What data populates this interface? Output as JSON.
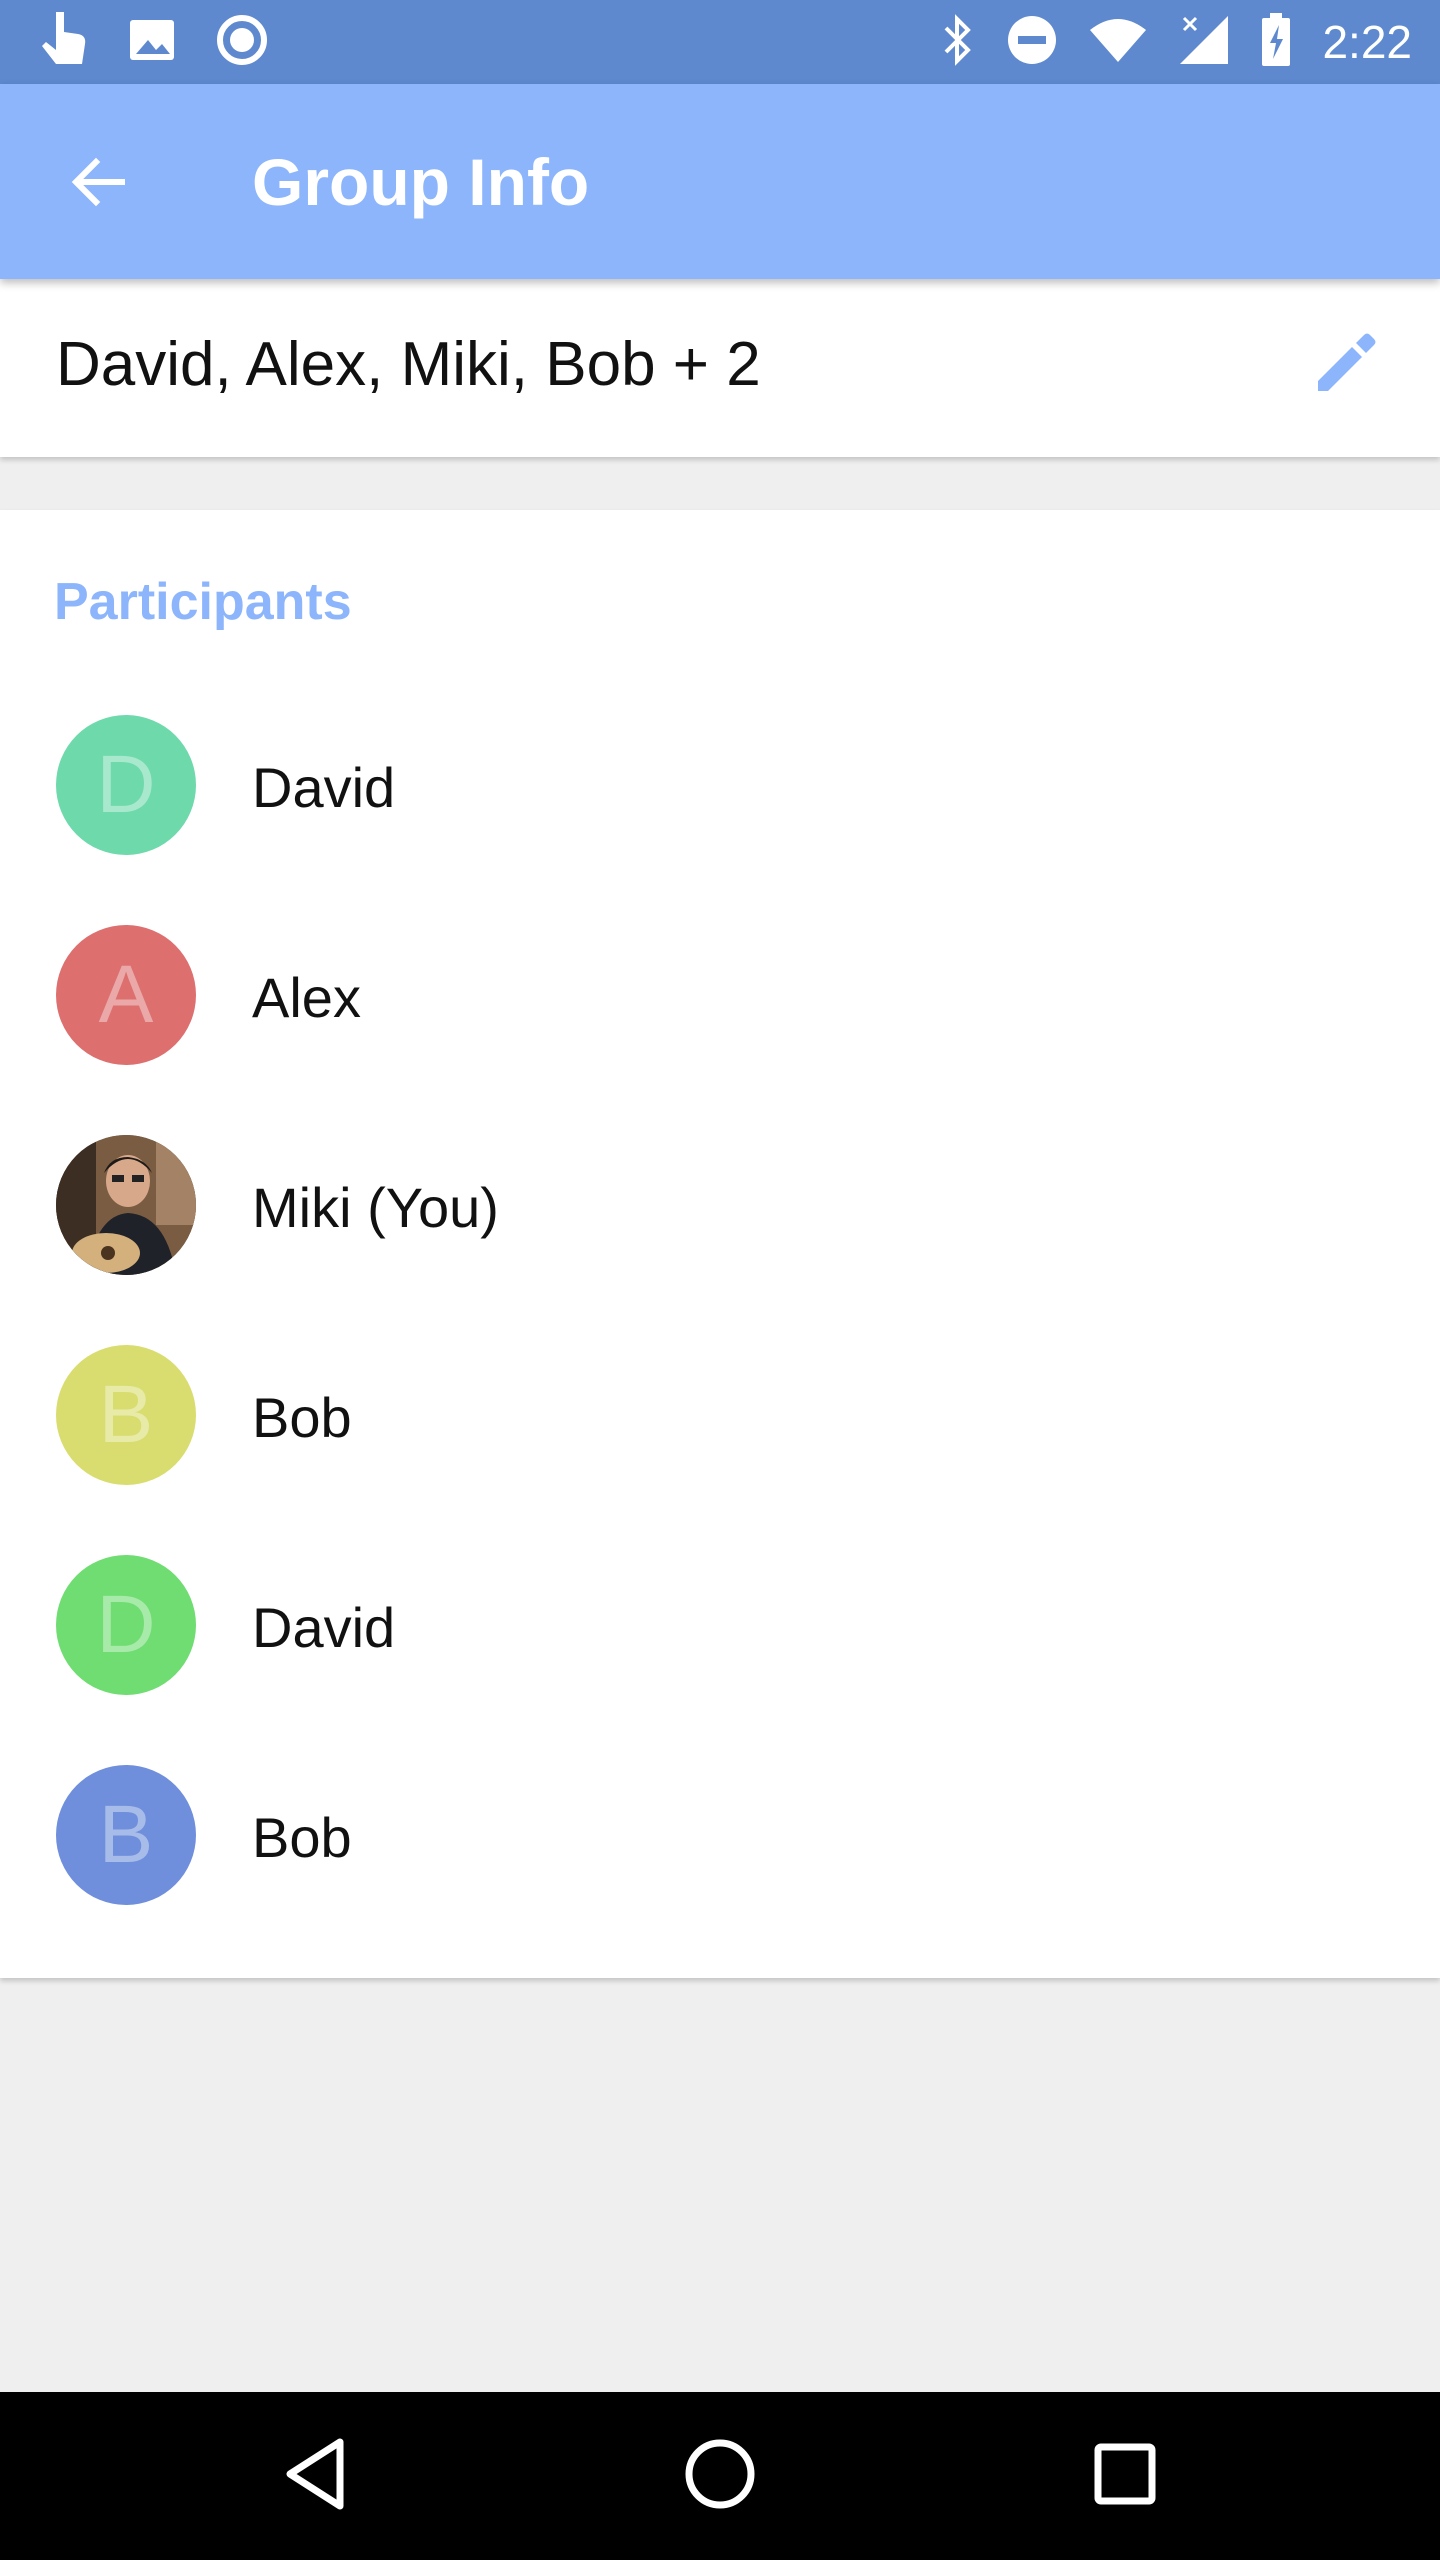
{
  "status_bar": {
    "time": "2:22",
    "left_icons": [
      "touch-icon",
      "image-icon",
      "record-icon"
    ],
    "right_icons": [
      "bluetooth-icon",
      "do-not-disturb-icon",
      "wifi-icon",
      "signal-icon",
      "battery-charging-icon"
    ]
  },
  "app_bar": {
    "title": "Group Info",
    "back_icon": "arrow-back-icon"
  },
  "group": {
    "name": "David, Alex, Miki, Bob + 2",
    "edit_icon": "pencil-icon"
  },
  "participants": {
    "section_title": "Participants",
    "items": [
      {
        "name": "David",
        "initial": "D",
        "color": "#6ed9ab"
      },
      {
        "name": "Alex",
        "initial": "A",
        "color": "#dd6f6f"
      },
      {
        "name": "Miki (You)",
        "initial": "",
        "color": "#5a4a3c",
        "photo": true
      },
      {
        "name": "Bob",
        "initial": "B",
        "color": "#d9dd6f"
      },
      {
        "name": "David",
        "initial": "D",
        "color": "#6fdd71"
      },
      {
        "name": "Bob",
        "initial": "B",
        "color": "#6f8fdd"
      }
    ]
  },
  "nav_bar": {
    "buttons": [
      "back-triangle-icon",
      "home-circle-icon",
      "recents-square-icon"
    ]
  },
  "colors": {
    "status_bar": "#5e89cf",
    "app_bar": "#8cb5fc",
    "accent": "#8cb5fc",
    "background": "#efefef"
  }
}
